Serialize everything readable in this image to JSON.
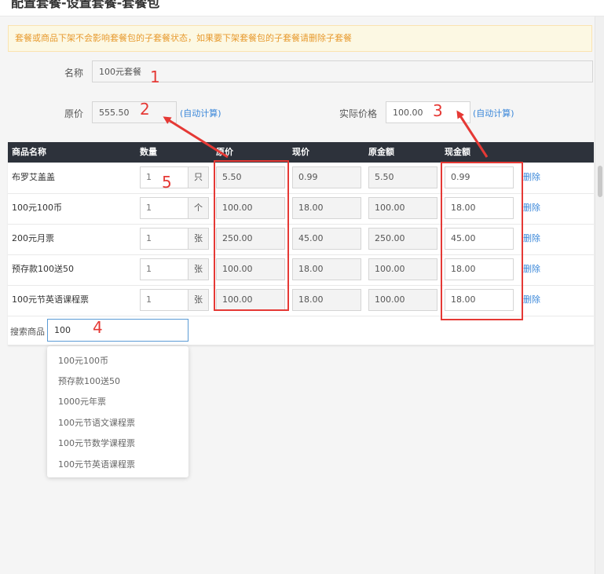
{
  "window": {
    "title": "配置套餐-设置套餐-套餐包"
  },
  "notice": "套餐或商品下架不会影响套餐包的子套餐状态，如果要下架套餐包的子套餐请删除子套餐",
  "form": {
    "name_label": "名称",
    "name_value": "100元套餐",
    "original_price_label": "原价",
    "original_price_value": "555.50",
    "auto_calc_label": "(自动计算)",
    "actual_price_label": "实际价格",
    "actual_price_value": "100.00"
  },
  "table": {
    "headers": [
      "商品名称",
      "数量",
      "原价",
      "现价",
      "原金额",
      "现金额"
    ],
    "delete_label": "删除",
    "rows": [
      {
        "name": "布罗艾盖盖",
        "qty": "1",
        "unit": "只",
        "orig_price": "5.50",
        "cur_price": "0.99",
        "orig_amount": "5.50",
        "cur_amount": "0.99"
      },
      {
        "name": "100元100币",
        "qty": "1",
        "unit": "个",
        "orig_price": "100.00",
        "cur_price": "18.00",
        "orig_amount": "100.00",
        "cur_amount": "18.00"
      },
      {
        "name": "200元月票",
        "qty": "1",
        "unit": "张",
        "orig_price": "250.00",
        "cur_price": "45.00",
        "orig_amount": "250.00",
        "cur_amount": "45.00"
      },
      {
        "name": "预存款100送50",
        "qty": "1",
        "unit": "张",
        "orig_price": "100.00",
        "cur_price": "18.00",
        "orig_amount": "100.00",
        "cur_amount": "18.00"
      },
      {
        "name": "100元节英语课程票",
        "qty": "1",
        "unit": "张",
        "orig_price": "100.00",
        "cur_price": "18.00",
        "orig_amount": "100.00",
        "cur_amount": "18.00"
      }
    ]
  },
  "search": {
    "label": "搜索商品",
    "value": "100",
    "suggestions": [
      "100元100币",
      "预存款100送50",
      "1000元年票",
      "100元节语文课程票",
      "100元节数学课程票",
      "100元节英语课程票"
    ]
  },
  "annotations": [
    "1",
    "2",
    "3",
    "4",
    "5"
  ],
  "colors": {
    "header_bg": "#2d323b",
    "link": "#3a87d9",
    "notice_text": "#e79a2f",
    "annotation": "#e53935"
  }
}
